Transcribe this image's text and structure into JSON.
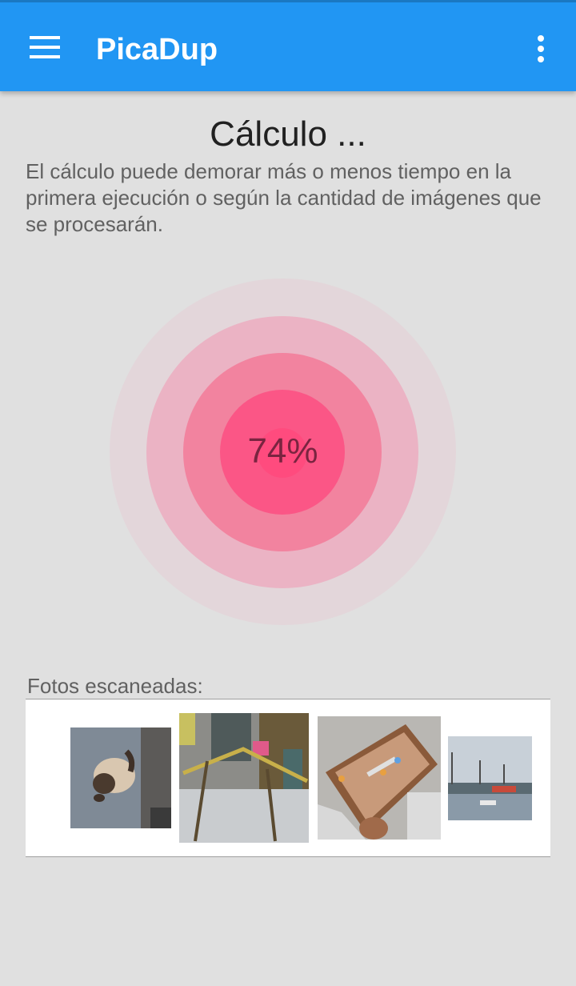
{
  "app_bar": {
    "title": "PicaDup",
    "menu_icon": "hamburger-menu-icon",
    "overflow_icon": "more-vert-icon",
    "color": "#2196f3"
  },
  "calculation": {
    "title": "Cálculo ...",
    "description": "El cálculo puede demorar más o menos tiempo en la primera ejecución o según la cantidad de imágenes que se procesarán.",
    "progress_label": "74%",
    "progress_value": 74
  },
  "scanned": {
    "label": "Fotos escaneadas:"
  },
  "colors": {
    "accent": "#ff4081",
    "background": "#e0e0e0"
  }
}
